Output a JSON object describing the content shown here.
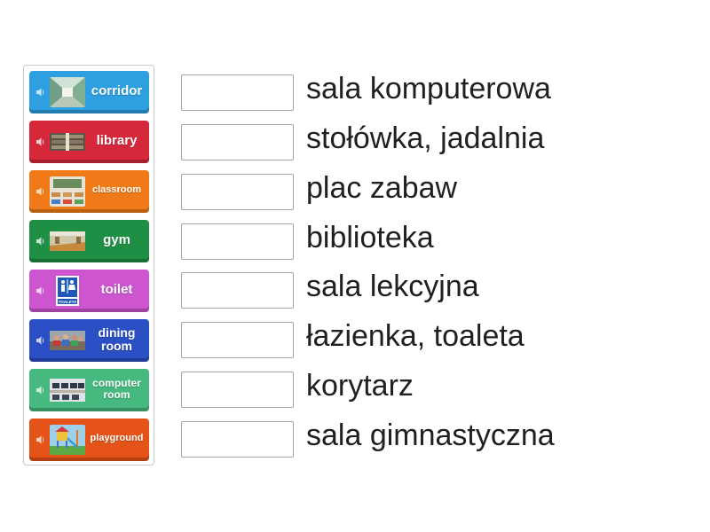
{
  "cards": [
    {
      "label": "corridor",
      "color": "#2e9fe0",
      "thumb": "corridor-photo"
    },
    {
      "label": "library",
      "color": "#d6283a",
      "thumb": "library-photo"
    },
    {
      "label": "classroom",
      "color": "#f07a17",
      "thumb": "classroom-photo"
    },
    {
      "label": "gym",
      "color": "#1f8f45",
      "thumb": "gym-photo"
    },
    {
      "label": "toilet",
      "color": "#cd55cf",
      "thumb": "toilet-sign",
      "thumb_text": "TOALETA"
    },
    {
      "label": "dining\nroom",
      "color": "#2b4fc4",
      "thumb": "dining-room-photo"
    },
    {
      "label": "computer\nroom",
      "color": "#46b97e",
      "thumb": "computer-room-photo"
    },
    {
      "label": "playground",
      "color": "#e55318",
      "thumb": "playground-photo"
    }
  ],
  "targets": [
    "sala komputerowa",
    "stołówka, jadalnia",
    "plac zabaw",
    "biblioteka",
    "sala lekcyjna",
    "łazienka, toaleta",
    "korytarz",
    "sala gimnastyczna"
  ],
  "icons": {
    "speaker": "speaker-icon"
  }
}
